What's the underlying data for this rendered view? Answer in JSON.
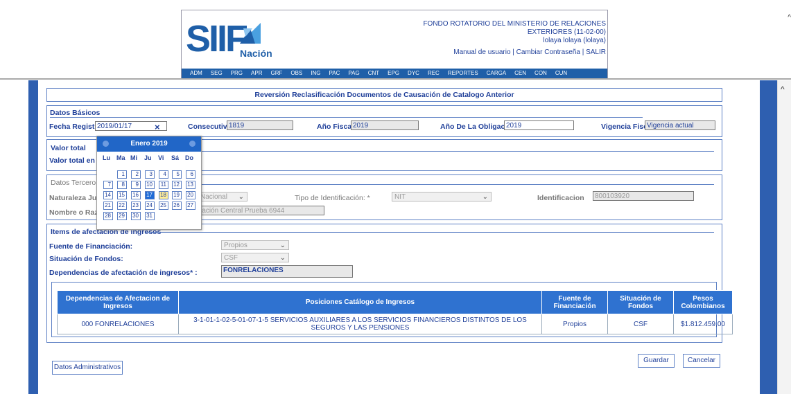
{
  "header": {
    "org_line1": "FONDO ROTATORIO DEL MINISTERIO DE RELACIONES",
    "org_line2": "EXTERIORES (11-02-00)",
    "user": "lolaya lolaya (lolaya)",
    "links": "Manual de usuario | Cambiar Contraseña | SALIR",
    "logo_text": "SIIF",
    "logo_sub": "Nación",
    "menu": [
      "ADM",
      "SEG",
      "PRG",
      "APR",
      "GRF",
      "OBS",
      "ING",
      "PAC",
      "PAG",
      "CNT",
      "EPG",
      "DYC",
      "REC",
      "REPORTES",
      "CARGA",
      "CEN",
      "CON",
      "CUN"
    ]
  },
  "page_title": "Reversión Reclasificación Documentos de Causación de Catalogo Anterior",
  "datos_basicos": {
    "legend": "Datos Básicos",
    "fecha_label": "Fecha Registro:",
    "fecha_value": "2019/01/17",
    "consecutivo_label": "Consecutivo:",
    "consecutivo_value": "1819",
    "anio_fiscal_label": "Año Fiscal:",
    "anio_fiscal_value": "2019",
    "anio_oblig_label": "Año De La Obligacion:",
    "anio_oblig_value": "2019",
    "vigencia_label": "Vigencia Fiscal:",
    "vigencia_value": "Vigencia actual"
  },
  "valor_total": {
    "legend": "Valor total",
    "label": "Valor total en pe"
  },
  "datos_tercero": {
    "legend": "Datos Tercero",
    "naturaleza_label": "Naturaleza Juríd",
    "naturaleza_value": "Nacional",
    "tipo_id_label": "Tipo de Identificación: *",
    "tipo_id_value": "NIT",
    "identificacion_label": "Identificacion",
    "identificacion_value": "800103920",
    "nombre_label": "Nombre o Razón",
    "nombre_value": "ración Central Prueba 6944"
  },
  "items": {
    "legend": "Items de afectación de ingresos",
    "fuente_label": "Fuente de Financiación:",
    "fuente_value": "Propios",
    "situacion_label": "Situación de Fondos:",
    "situacion_value": "CSF",
    "dependencias_label": "Dependencias de afectación de ingresos* :",
    "dependencias_value": "FONRELACIONES"
  },
  "table": {
    "headers": [
      "Dependencias de Afectacion de Ingresos",
      "Posiciones Catálogo de Ingresos",
      "Fuente de Financiación",
      "Situación de Fondos",
      "Pesos Colombianos"
    ],
    "rows": [
      [
        "000 FONRELACIONES",
        "3-1-01-1-02-5-01-07-1-5 SERVICIOS AUXILIARES A LOS SERVICIOS FINANCIEROS DISTINTOS DE LOS SEGUROS Y LAS PENSIONES",
        "Propios",
        "CSF",
        "$1.812.459,00"
      ]
    ]
  },
  "buttons": {
    "datos_admin": "Datos Administrativos",
    "guardar": "Guardar",
    "cancelar": "Cancelar"
  },
  "calendar": {
    "month": "Enero 2019",
    "dow": [
      "Lu",
      "Ma",
      "Mi",
      "Ju",
      "Vi",
      "Sá",
      "Do"
    ],
    "selected_day": 17,
    "today_day": 18,
    "first_weekday_index": 1,
    "days_in_month": 31
  },
  "colors": {
    "brand": "#1f5fa8",
    "accent": "#2f72d0",
    "label": "#1f3f99"
  }
}
